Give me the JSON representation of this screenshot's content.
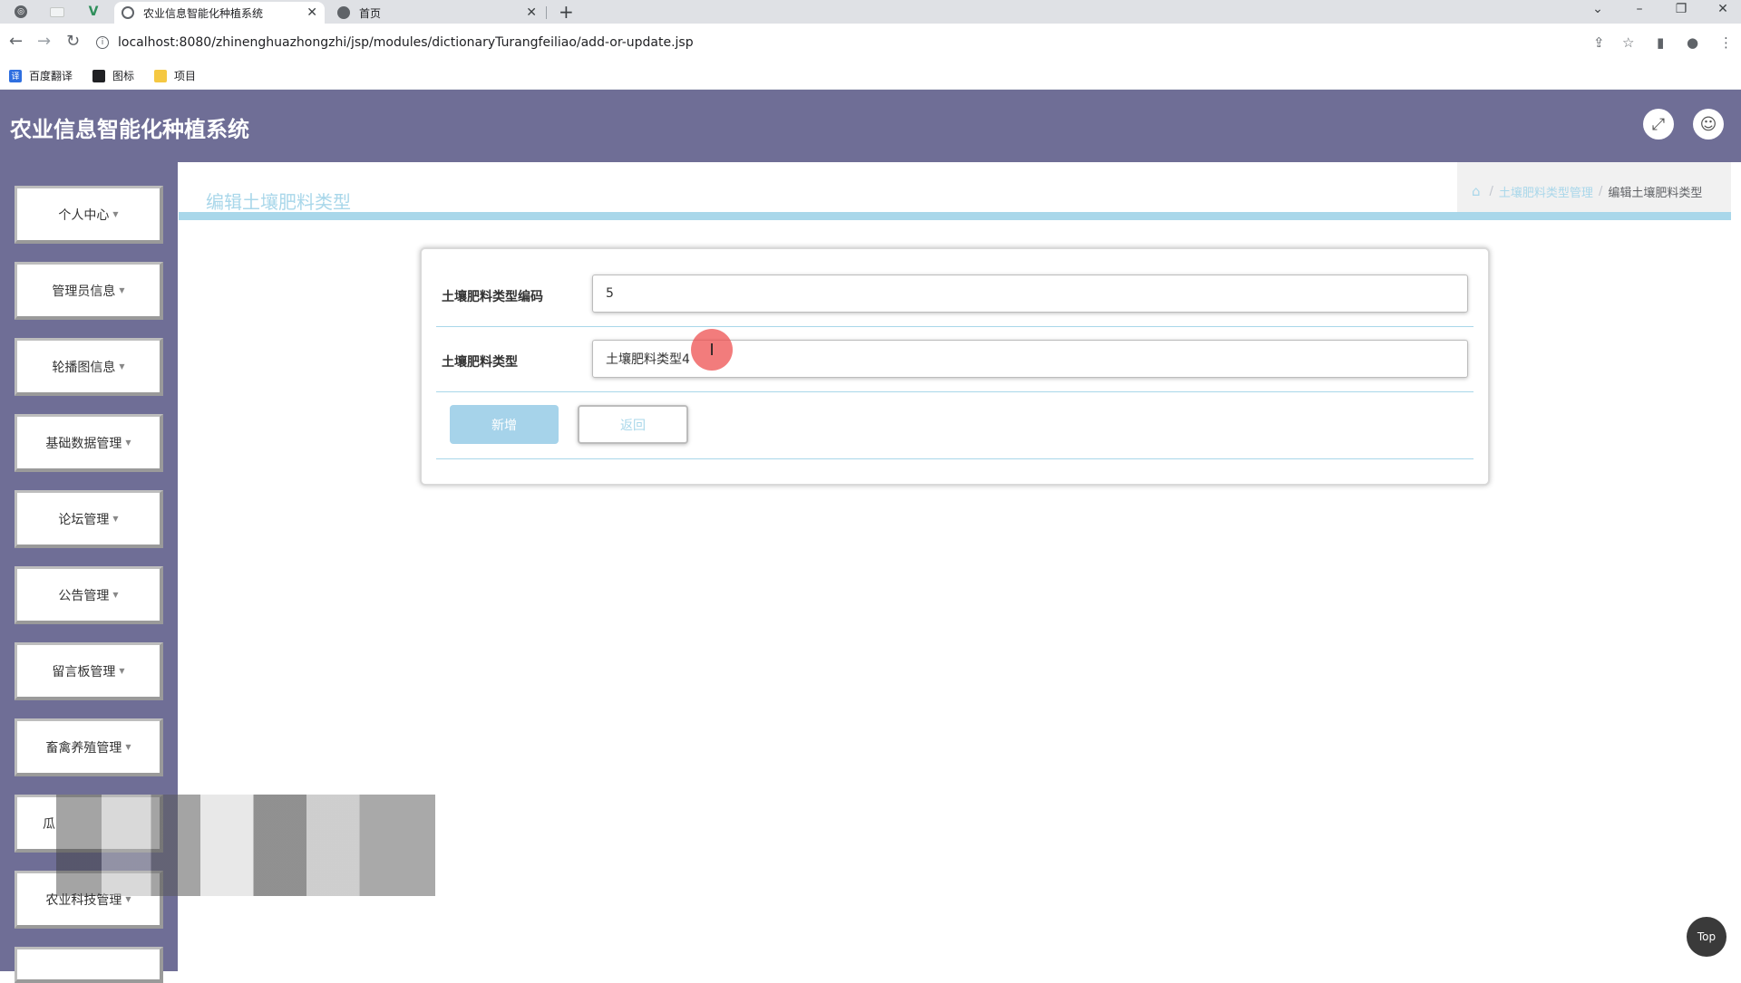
{
  "browser": {
    "tabs": [
      {
        "title": "农业信息智能化种植系统",
        "active": true
      },
      {
        "title": "首页",
        "active": false
      }
    ],
    "url": "localhost:8080/zhinenghuazhongzhi/jsp/modules/dictionaryTurangfeiliao/add-or-update.jsp",
    "bookmarks": [
      "百度翻译",
      "图标",
      "项目"
    ]
  },
  "header": {
    "title": "农业信息智能化种植系统"
  },
  "sidebar": {
    "items": [
      {
        "label": "个人中心"
      },
      {
        "label": "管理员信息"
      },
      {
        "label": "轮播图信息"
      },
      {
        "label": "基础数据管理"
      },
      {
        "label": "论坛管理"
      },
      {
        "label": "公告管理"
      },
      {
        "label": "留言板管理"
      },
      {
        "label": "畜禽养殖管理"
      },
      {
        "label": "瓜"
      },
      {
        "label": "农业科技管理"
      }
    ]
  },
  "main": {
    "page_heading": "编辑土壤肥料类型",
    "breadcrumb": {
      "parent": "土壤肥料类型管理",
      "current": "编辑土壤肥料类型"
    },
    "form": {
      "fields": [
        {
          "label": "土壤肥料类型编码",
          "value": "5"
        },
        {
          "label": "土壤肥料类型",
          "value": "土壤肥料类型4"
        }
      ],
      "add_label": "新增",
      "back_label": "返回"
    },
    "top_label": "Top"
  },
  "colors": {
    "header_bg": "#6f6e96",
    "accent": "#a9d7ea",
    "add_button": "#a6d3ea"
  }
}
